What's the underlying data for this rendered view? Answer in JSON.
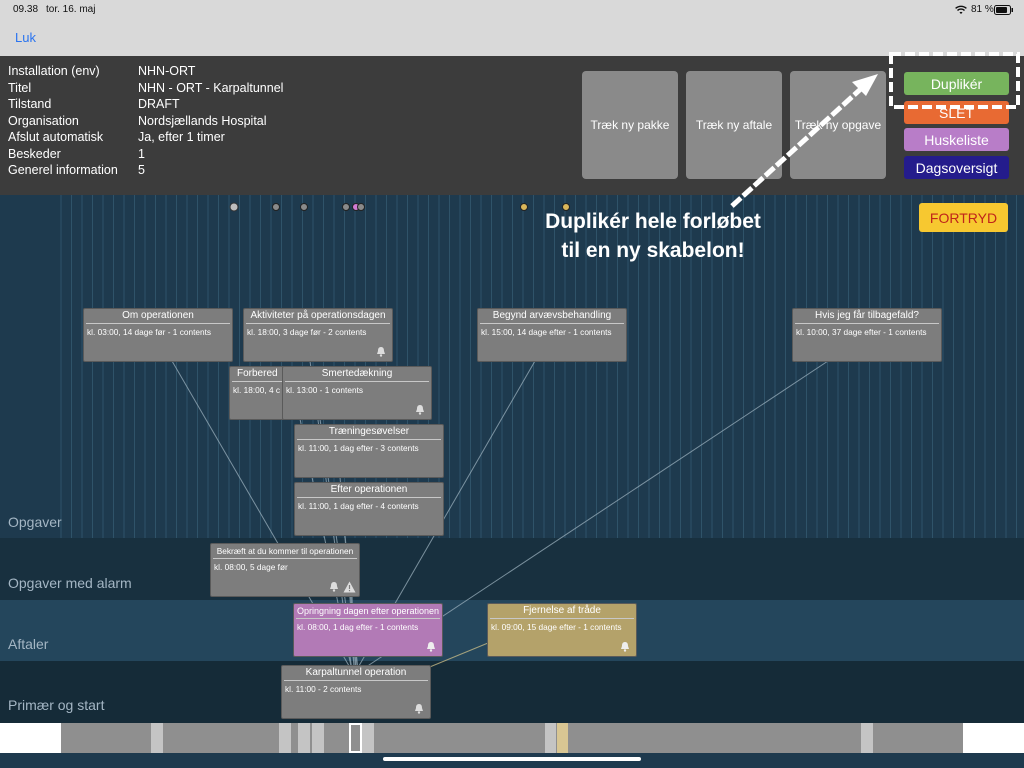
{
  "status": {
    "time": "09.38",
    "date": "tor. 16. maj",
    "battery": "81 %",
    "wifi_icon": "wifi-icon",
    "battery_icon": "battery-icon"
  },
  "nav": {
    "close_label": "Luk"
  },
  "info": [
    {
      "key": "Installation (env)",
      "value": "NHN-ORT"
    },
    {
      "key": "Titel",
      "value": "NHN - ORT - Karpaltunnel"
    },
    {
      "key": "Tilstand",
      "value": "DRAFT"
    },
    {
      "key": "Organisation",
      "value": "Nordsjællands Hospital"
    },
    {
      "key": "Afslut automatisk",
      "value": "Ja, efter 1 timer"
    },
    {
      "key": "Beskeder",
      "value": "1"
    },
    {
      "key": "Generel information",
      "value": "5"
    }
  ],
  "drag_buttons": [
    "Træk ny pakke",
    "Træk ny aftale",
    "Træk ny opgave"
  ],
  "side_buttons": {
    "duplicate": "Duplikér",
    "delete": "SLET",
    "reminders": "Huskeliste",
    "day_overview": "Dagsoversigt",
    "undo": "FORTRYD"
  },
  "annotation": {
    "line1": "Duplikér hele forløbet",
    "line2": "til en ny skabelon!"
  },
  "colors": {
    "duplicate": "#77b45d",
    "delete": "#e86a33",
    "reminders": "#b87dc8",
    "day_overview": "#241c8c",
    "undo": "#f7c830",
    "card": "#7d7d7d",
    "card_appointment": "#b27ab6",
    "card_removal": "#b4a26a"
  },
  "lanes": {
    "tasks": "Opgaver",
    "alarm_tasks": "Opgaver med alarm",
    "appointments": "Aftaler",
    "primary": "Primær og start"
  },
  "cards": {
    "about": {
      "title": "Om operationen",
      "sub": "kl. 03:00, 14 dage før - 1 contents"
    },
    "activities": {
      "title": "Aktiviteter på operationsdagen",
      "sub": "kl. 18:00, 3 dage før - 2 contents"
    },
    "rehab": {
      "title": "Begynd arvævsbehandling",
      "sub": "kl. 15:00, 14 dage efter - 1 contents"
    },
    "relapse": {
      "title": "Hvis jeg får tilbagefald?",
      "sub": "kl. 10:00, 37 dage efter - 1 contents"
    },
    "prepare": {
      "title": "Forbered",
      "sub": "kl. 18:00, 4 c"
    },
    "pain": {
      "title": "Smertedækning",
      "sub": "kl. 13:00 - 1 contents"
    },
    "exercises": {
      "title": "Træningesøvelser",
      "sub": "kl. 11:00, 1 dag efter - 3 contents"
    },
    "after": {
      "title": "Efter operationen",
      "sub": "kl. 11:00, 1 dag efter - 4 contents"
    },
    "confirm": {
      "title": "Bekræft at du kommer til operationen",
      "sub": "kl. 08:00, 5 dage før"
    },
    "call": {
      "title": "Opringning dagen efter operationen",
      "sub": "kl. 08:00, 1 dag efter - 1 contents"
    },
    "stitches": {
      "title": "Fjernelse af tråde",
      "sub": "kl. 09:00, 15 dage efter - 1 contents"
    },
    "surgery": {
      "title": "Karpaltunnel operation",
      "sub": "kl. 11:00 - 2 contents"
    }
  }
}
